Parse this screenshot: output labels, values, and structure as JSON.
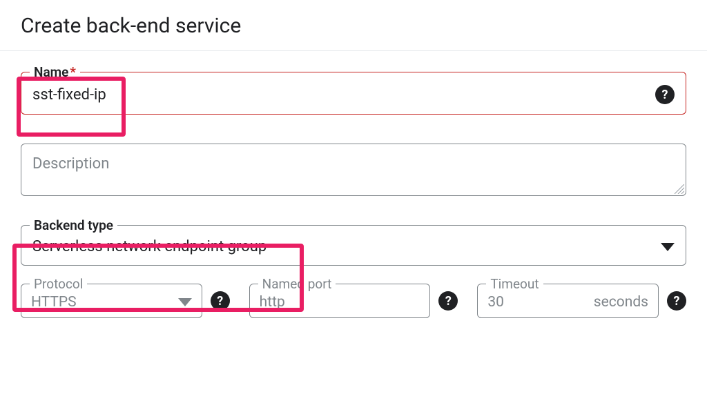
{
  "header": {
    "title": "Create back-end service"
  },
  "form": {
    "name": {
      "label": "Name",
      "required_mark": "*",
      "value": "sst-fixed-ip"
    },
    "description": {
      "placeholder": "Description"
    },
    "backend_type": {
      "label": "Backend type",
      "value": "Serverless network endpoint group"
    },
    "protocol": {
      "label": "Protocol",
      "value": "HTTPS"
    },
    "named_port": {
      "label": "Named port",
      "value": "http"
    },
    "timeout": {
      "label": "Timeout",
      "value": "30",
      "unit": "seconds"
    }
  }
}
